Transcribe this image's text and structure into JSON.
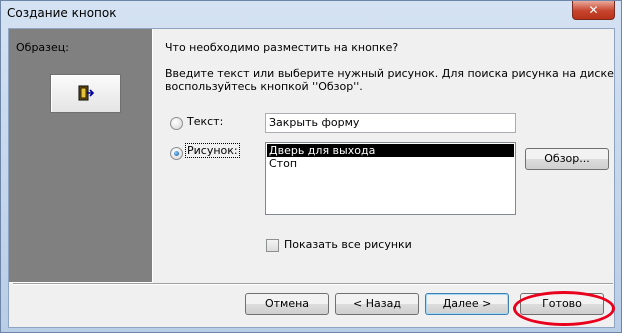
{
  "window": {
    "title": "Создание кнопок",
    "close_glyph": "✕"
  },
  "sample": {
    "label": "Образец:",
    "icon": "exit-door-icon"
  },
  "prompt": {
    "question": "Что необходимо разместить на кнопке?",
    "hint_line1": "Введите текст или выберите нужный рисунок.  Для поиска рисунка на диске",
    "hint_line2": "воспользуйтесь кнопкой ''Обзор''."
  },
  "options": {
    "text_label": "Текст:",
    "text_value": "Закрыть форму",
    "picture_label": "Рисунок:",
    "selected_option": "picture",
    "pictures": [
      {
        "label": "Дверь для выхода",
        "selected": true
      },
      {
        "label": "Стоп",
        "selected": false
      }
    ],
    "browse_label": "Обзор...",
    "show_all_label": "Показать все рисунки",
    "show_all_checked": false
  },
  "buttons": {
    "cancel": "Отмена",
    "back": "< Назад",
    "next": "Далее >",
    "finish": "Готово"
  },
  "colors": {
    "annotation_ellipse": "#e8001c",
    "list_selection": "#000000"
  }
}
